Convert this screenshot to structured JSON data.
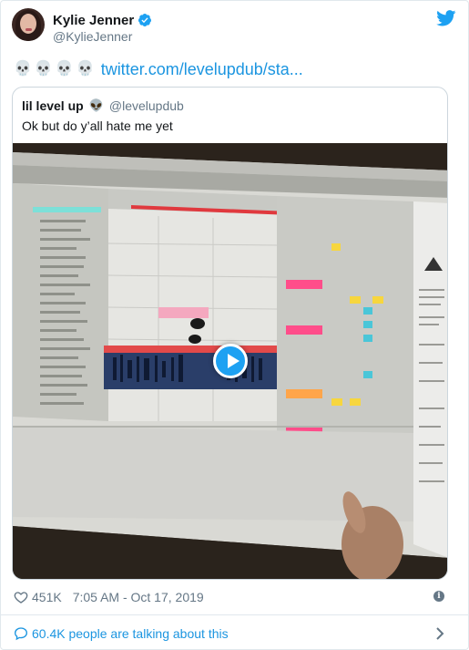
{
  "tweet": {
    "author": {
      "display_name": "Kylie Jenner",
      "handle": "@KylieJenner",
      "verified": true
    },
    "emojis": [
      "skull",
      "skull",
      "skull",
      "skull"
    ],
    "link_text": "twitter.com/levelupdub/sta...",
    "quoted": {
      "display_name": "lil level up",
      "avatar_emoji": "👽",
      "handle": "@levelupdub",
      "text": "Ok but do y’all hate me yet"
    },
    "likes": "451K",
    "timestamp": "7:05 AM - Oct 17, 2019",
    "talking": "60.4K people are talking about this"
  },
  "colors": {
    "link": "#1b95e0",
    "secondary_text": "#657786",
    "play_button": "#1da1f2"
  },
  "icons": [
    "twitter-bird-icon",
    "verified-badge-icon",
    "skull-icon",
    "play-icon",
    "heart-icon",
    "info-icon",
    "comment-bubble-icon",
    "chevron-right-icon"
  ]
}
